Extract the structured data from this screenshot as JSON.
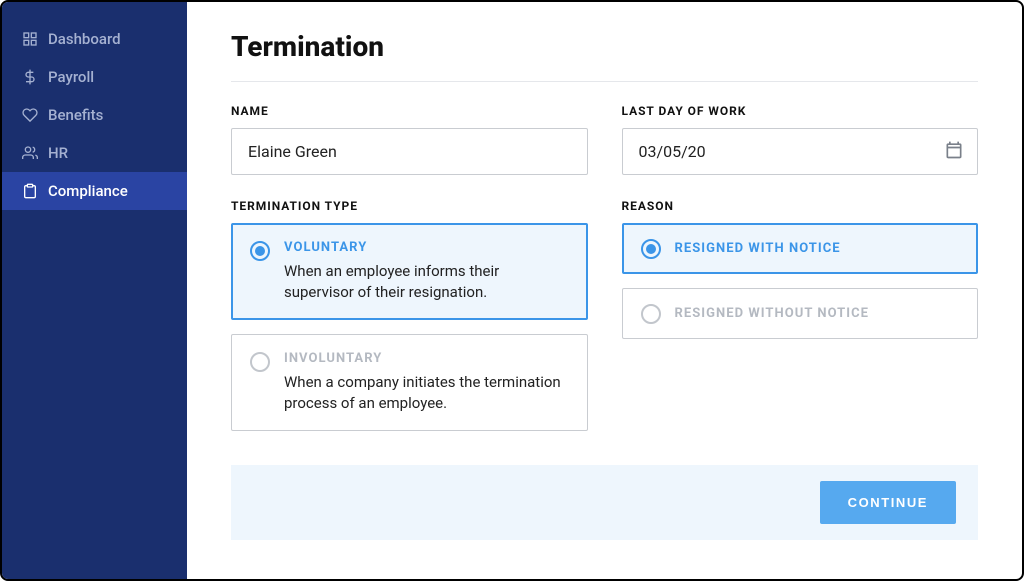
{
  "sidebar": {
    "items": [
      {
        "label": "Dashboard",
        "active": false
      },
      {
        "label": "Payroll",
        "active": false
      },
      {
        "label": "Benefits",
        "active": false
      },
      {
        "label": "HR",
        "active": false
      },
      {
        "label": "Compliance",
        "active": true
      }
    ]
  },
  "page": {
    "title": "Termination"
  },
  "form": {
    "name_label": "NAME",
    "name_value": "Elaine Green",
    "last_day_label": "LAST DAY OF WORK",
    "last_day_value": "03/05/20",
    "termination_type_label": "TERMINATION TYPE",
    "termination_options": [
      {
        "title": "VOLUNTARY",
        "desc": "When an employee informs their supervisor of their resignation.",
        "selected": true
      },
      {
        "title": "INVOLUNTARY",
        "desc": "When a company initiates the termination process of an employee.",
        "selected": false
      }
    ],
    "reason_label": "REASON",
    "reason_options": [
      {
        "title": "RESIGNED WITH NOTICE",
        "selected": true
      },
      {
        "title": "RESIGNED WITHOUT NOTICE",
        "selected": false
      }
    ]
  },
  "footer": {
    "continue_label": "CONTINUE"
  }
}
